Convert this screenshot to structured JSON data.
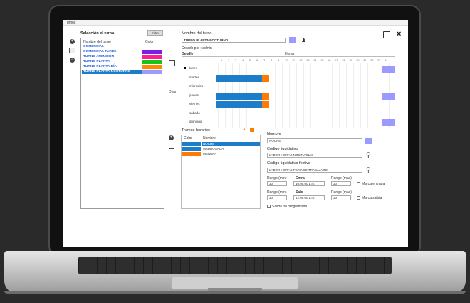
{
  "window": {
    "title": "Turnos"
  },
  "left": {
    "header": "Selección el turno",
    "filter_button": "Filtro",
    "col_name": "Nombre del turno",
    "col_color": "Color"
  },
  "shifts": [
    {
      "name": "COMERCIAL",
      "color": "#ffffff"
    },
    {
      "name": "COMERCIAL TARDE",
      "color": "#7c1ee8"
    },
    {
      "name": "TURNO ATENCIÓN",
      "color": "#ff1f8f"
    },
    {
      "name": "TURNO PLANTA",
      "color": "#17c51a"
    },
    {
      "name": "TURNO PLANTA DÍA",
      "color": "#ff8a00"
    },
    {
      "name": "TURNO PLANTA NOCTURNO",
      "color": "#9a9aff"
    }
  ],
  "detail": {
    "name_label": "Nombre del turno",
    "name_value": "TURNO PLANTA NOCTURNO",
    "creator": "Creado por : admin",
    "detalle": "Detalle",
    "horas": "Horas",
    "dias": "Días",
    "hours": [
      "1",
      "2",
      "3",
      "4",
      "5",
      "6",
      "7",
      "8",
      "9",
      "10",
      "11",
      "12",
      "13",
      "14",
      "15",
      "16",
      "17",
      "18",
      "19",
      "20",
      "21",
      "22",
      "23",
      "24"
    ],
    "days": [
      "lunes",
      "martes",
      "miércoles",
      "jueves",
      "viernes",
      "sábado",
      "domingo"
    ]
  },
  "tramos": {
    "title": "Tramos horarios",
    "col_color": "Color",
    "col_name": "Nombre",
    "rows": [
      {
        "color": "#1e7dc9",
        "name": "NOCHE"
      },
      {
        "color": "#1e7dc9",
        "name": "MADRUGADA"
      },
      {
        "color": "#ff7a00",
        "name": "MAÑANA"
      }
    ]
  },
  "form": {
    "nombre_label": "Nombre",
    "nombre_value": "NOCHE",
    "cod_liq_label": "Código liquidativo",
    "cod_liq_value": "LABOR HORAS NOCTURNAS",
    "cod_fest_label": "Código liquidativo festivo",
    "cod_fest_value": "LABOR HORAS FERIADO TRABAJADO",
    "margen_min": "Rango (min)",
    "margen_max": "Rango (max)",
    "entra": "Entra",
    "sale": "Sale",
    "val_min_1": "30",
    "val_entra": "10:00:00 p.m.",
    "val_max_1": "30",
    "val_min_2": "30",
    "val_sale": "12:00:00 a.m.",
    "val_max_2": "30",
    "chk_entrada": "Marca entrada",
    "chk_salida": "Marca salida",
    "chk_programada": "Salida no programada"
  }
}
